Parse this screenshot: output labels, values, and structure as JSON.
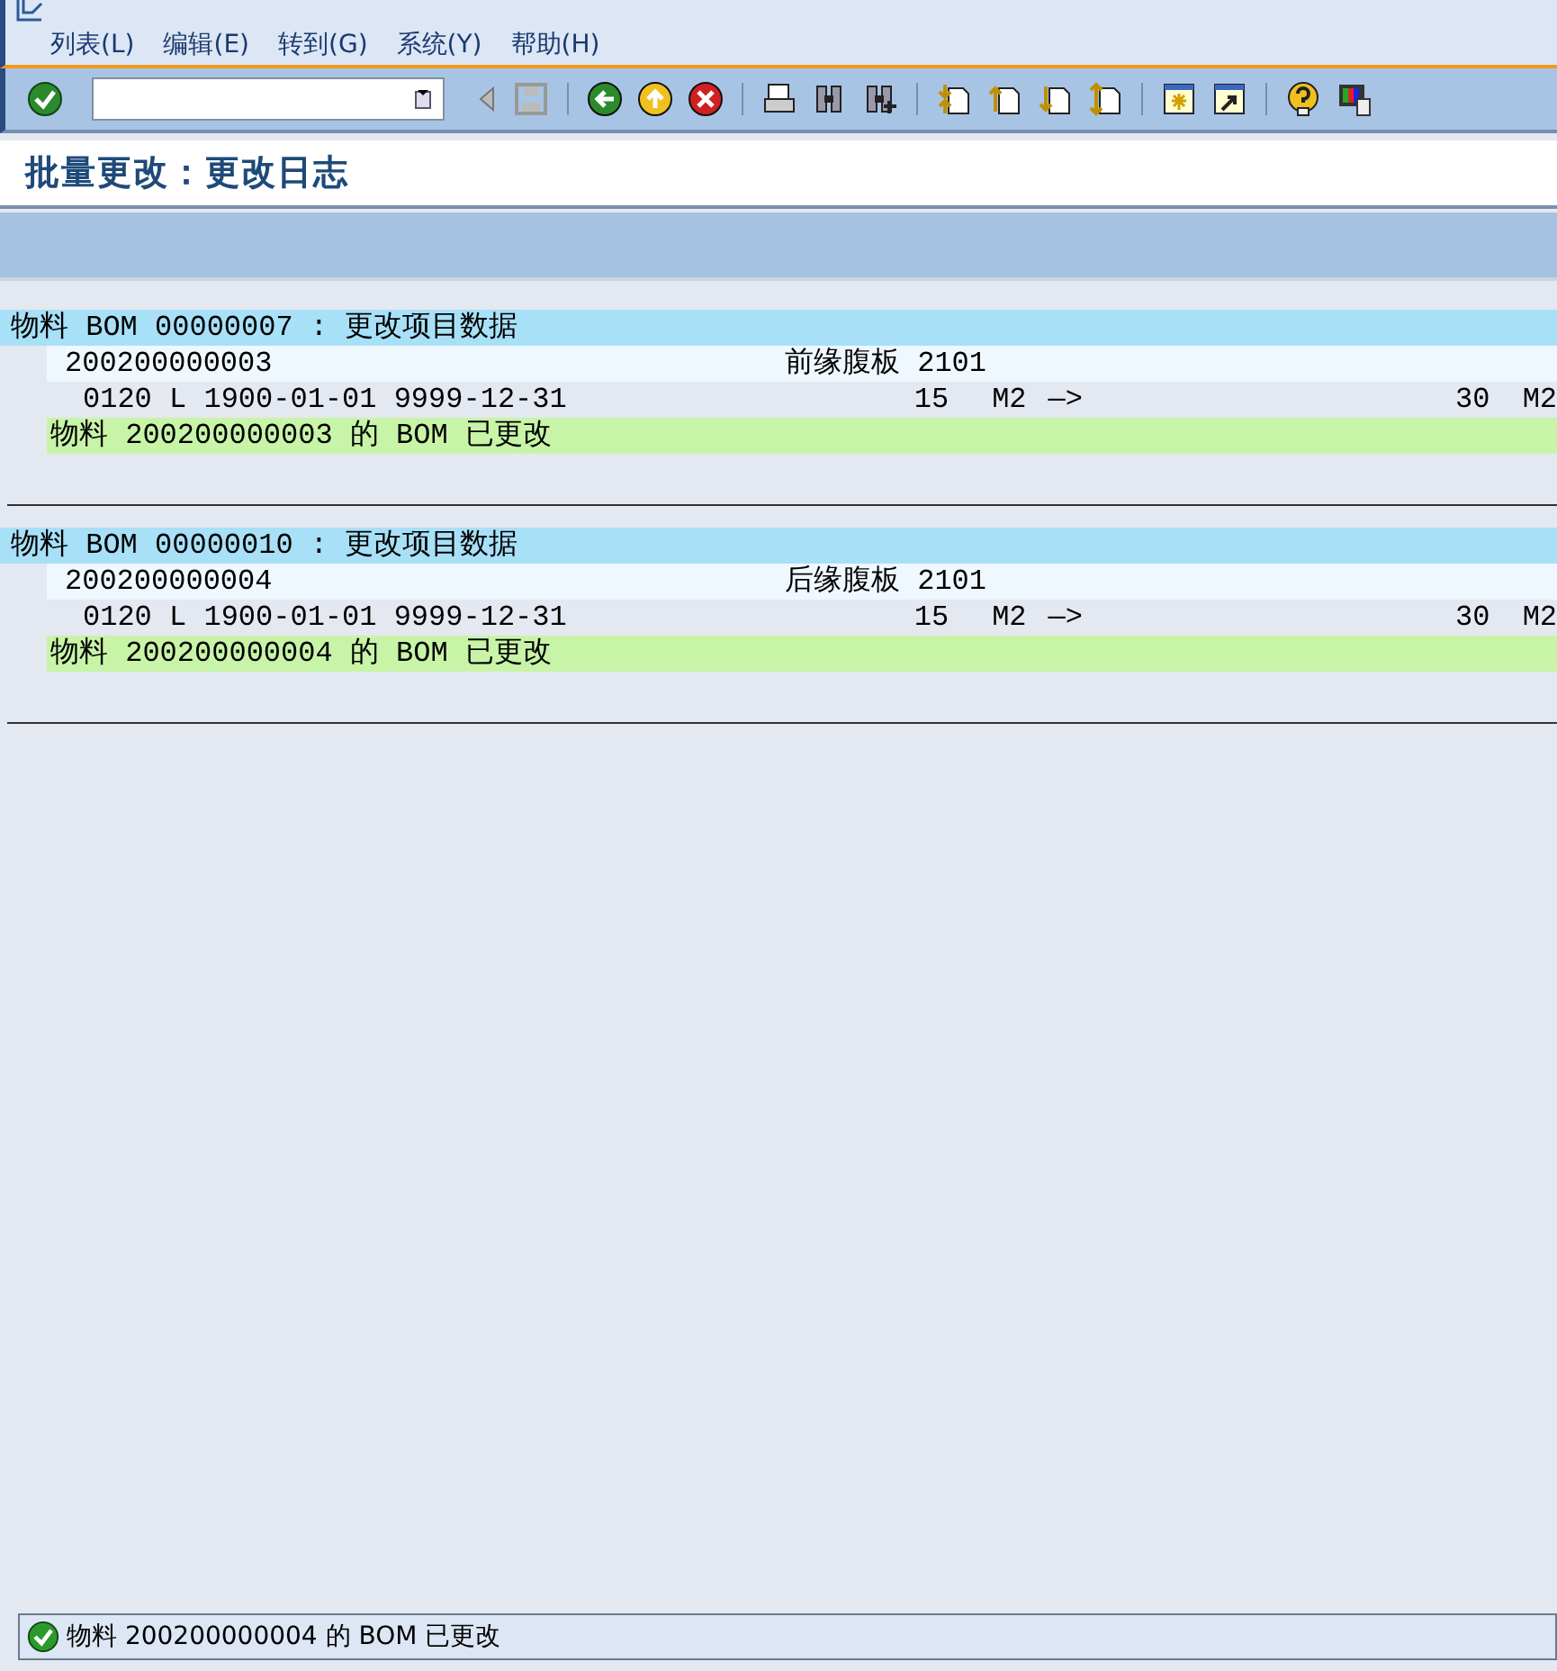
{
  "menu": [
    {
      "label": "列表(L)"
    },
    {
      "label": "编辑(E)"
    },
    {
      "label": "转到(G)"
    },
    {
      "label": "系统(Y)"
    },
    {
      "label": "帮助(H)"
    }
  ],
  "title": "批量更改：更改日志",
  "blocks": [
    {
      "header": "物料 BOM 00000007 : 更改项目数据",
      "material": "200200000003",
      "description": "前缘腹板 2101",
      "validity": "0120 L 1900-01-01 9999-12-31",
      "qty_from": "15",
      "unit_from": "M2",
      "arrow": "—>",
      "qty_to": "30",
      "unit_to": "M2",
      "message": "物料 200200000003 的 BOM 已更改"
    },
    {
      "header": "物料 BOM 00000010 : 更改项目数据",
      "material": "200200000004",
      "description": "后缘腹板 2101",
      "validity": "0120 L 1900-01-01 9999-12-31",
      "qty_from": "15",
      "unit_from": "M2",
      "arrow": "—>",
      "qty_to": "30",
      "unit_to": "M2",
      "message": "物料 200200000004 的 BOM 已更改"
    }
  ],
  "status": {
    "kind": "success",
    "message": "物料 200200000004 的 BOM 已更改"
  }
}
